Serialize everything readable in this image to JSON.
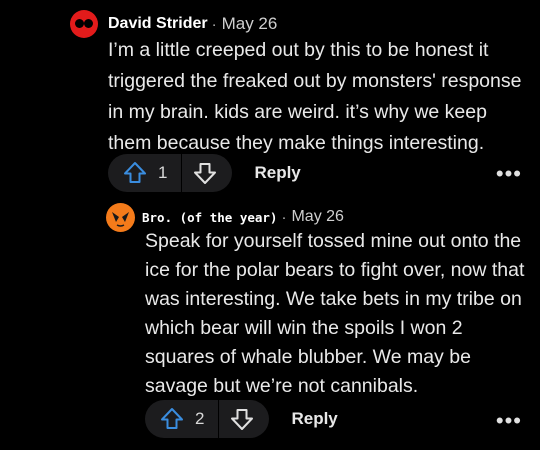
{
  "comments": [
    {
      "username": "David Strider",
      "date": "May 26",
      "separator": "·",
      "body": "I’m a little creeped out by this to be honest it triggered the freaked out by monsters' response in my brain. kids are weird. it’s why we keep them because they make things interesting.",
      "upvotes": "1",
      "reply_label": "Reply",
      "more_label": "•••",
      "avatar_color": "#e21b1b"
    },
    {
      "username": "Bro. (of the year)",
      "date": "May 26",
      "separator": "·",
      "body": "Speak for yourself tossed mine out onto the ice for the polar bears to fight over, now that was interesting. We take bets in my tribe on which bear will win the spoils I won 2 squares of whale blubber. We may be savage but we’re not cannibals.",
      "upvotes": "2",
      "reply_label": "Reply",
      "more_label": "•••",
      "avatar_color": "#f47b1a"
    }
  ],
  "icons": {
    "upvote": "upvote-arrow-icon",
    "downvote": "downvote-arrow-icon",
    "upvote_color": "#3a8ddf"
  }
}
